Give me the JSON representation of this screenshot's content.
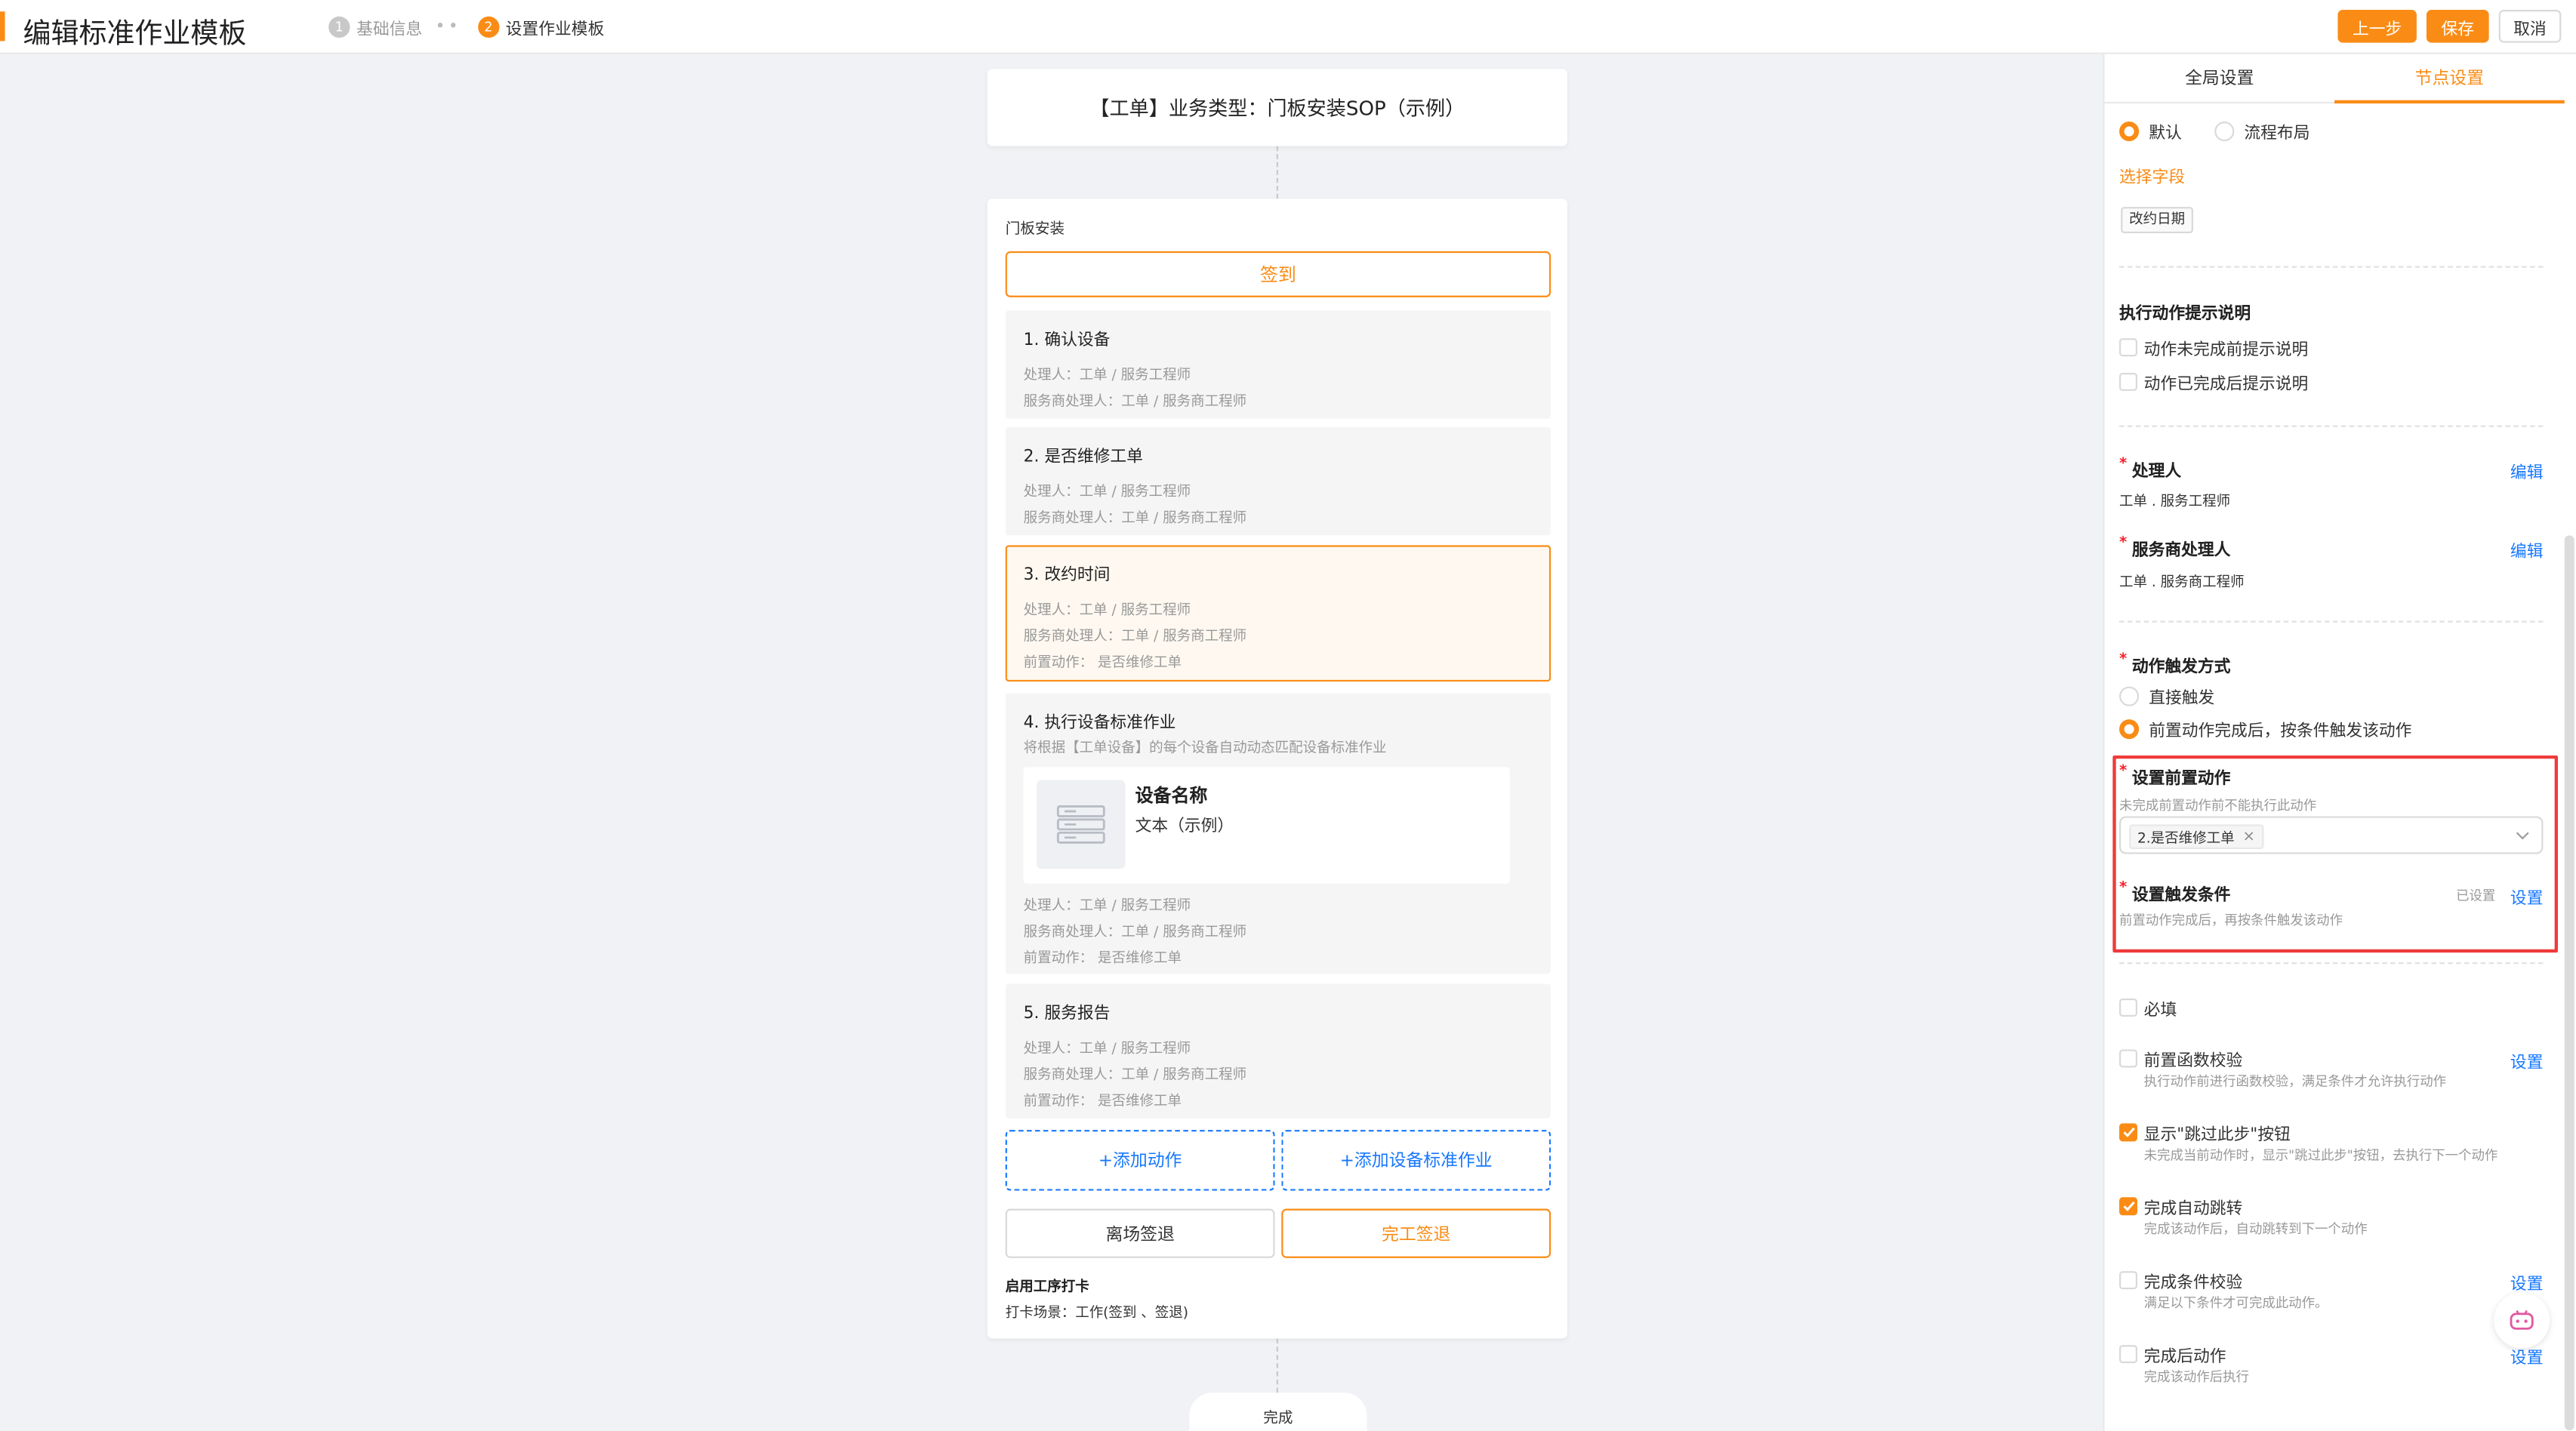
{
  "header": {
    "title": "编辑标准作业模板",
    "steps": [
      {
        "num": "1",
        "label": "基础信息"
      },
      {
        "num": "2",
        "label": "设置作业模板"
      }
    ],
    "buttons": {
      "prev": "上一步",
      "save": "保存",
      "cancel": "取消"
    }
  },
  "canvas": {
    "header_card": "【工单】业务类型：门板安装SOP（示例）",
    "flow_name": "门板安装",
    "sign_in": "签到",
    "nodes": [
      {
        "title": "1. 确认设备",
        "lines": [
          "处理人：工单 / 服务工程师",
          "服务商处理人：工单 / 服务商工程师"
        ]
      },
      {
        "title": "2. 是否维修工单",
        "lines": [
          "处理人：工单 / 服务工程师",
          "服务商处理人：工单 / 服务商工程师"
        ]
      },
      {
        "title": "3. 改约时间",
        "lines": [
          "处理人：工单 / 服务工程师",
          "服务商处理人：工单 / 服务商工程师",
          "前置动作：  是否维修工单"
        ]
      },
      {
        "title": "4. 执行设备标准作业",
        "desc": "将根据【工单设备】的每个设备自动动态匹配设备标准作业",
        "device_name": "设备名称",
        "device_text": "文本（示例）",
        "lines": [
          "处理人：工单 / 服务工程师",
          "服务商处理人：工单 / 服务商工程师",
          "前置动作：  是否维修工单"
        ]
      },
      {
        "title": "5. 服务报告",
        "lines": [
          "处理人：工单 / 服务工程师",
          "服务商处理人：工单 / 服务商工程师",
          "前置动作：  是否维修工单"
        ]
      }
    ],
    "add_action": "+添加动作",
    "add_device_sop": "+添加设备标准作业",
    "leave_sign_out": "离场签退",
    "finish_sign_out": "完工签退",
    "punch_title": "启用工序打卡",
    "punch_scene": "打卡场景：工作(签到 、签退)",
    "end_label": "完成"
  },
  "panel": {
    "tabs": [
      "全局设置",
      "节点设置"
    ],
    "layout_options": [
      "默认",
      "流程布局"
    ],
    "select_field_label": "选择字段",
    "field_tag": "改约日期",
    "tips_title": "执行动作提示说明",
    "tips_options": [
      "动作未完成前提示说明",
      "动作已完成后提示说明"
    ],
    "handler_title": "处理人",
    "handler_value": "工单 . 服务工程师",
    "vendor_handler_title": "服务商处理人",
    "vendor_handler_value": "工单 . 服务商工程师",
    "edit_link": "编辑",
    "trigger_title": "动作触发方式",
    "trigger_options": [
      "直接触发",
      "前置动作完成后，按条件触发该动作"
    ],
    "pre_action_title": "设置前置动作",
    "pre_action_hint": "未完成前置动作前不能执行此动作",
    "pre_action_selected": "2.是否维修工单",
    "condition_title": "设置触发条件",
    "condition_status": "已设置",
    "set_link": "设置",
    "condition_hint": "前置动作完成后，再按条件触发该动作",
    "checks": [
      {
        "label": "必填",
        "hint": "",
        "checked": false,
        "link": false
      },
      {
        "label": "前置函数校验",
        "hint": "执行动作前进行函数校验，满足条件才允许执行动作",
        "checked": false,
        "link": true
      },
      {
        "label": "显示\"跳过此步\"按钮",
        "hint": "未完成当前动作时，显示\"跳过此步\"按钮，去执行下一个动作",
        "checked": true,
        "link": false
      },
      {
        "label": "完成自动跳转",
        "hint": "完成该动作后，自动跳转到下一个动作",
        "checked": true,
        "link": false
      },
      {
        "label": "完成条件校验",
        "hint": "满足以下条件才可完成此动作。",
        "checked": false,
        "link": true
      },
      {
        "label": "完成后动作",
        "hint": "完成该动作后执行",
        "checked": false,
        "link": true
      }
    ]
  },
  "colors": {
    "accent": "#fa8c16",
    "link": "#1677ff",
    "highlight": "#ee3b3b"
  }
}
